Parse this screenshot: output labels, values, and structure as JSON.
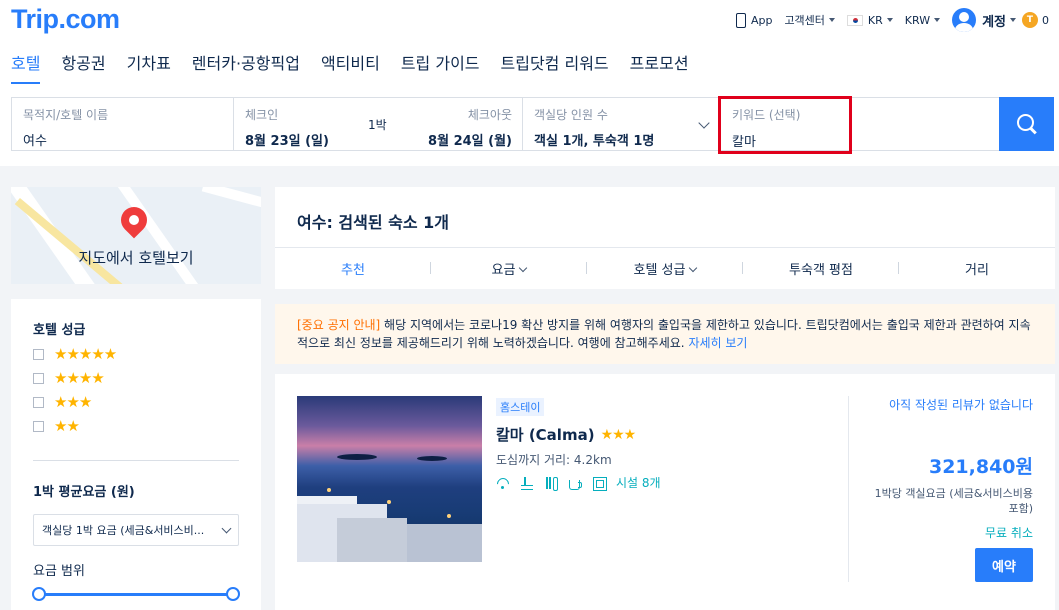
{
  "brand": {
    "logo": "Trip.com"
  },
  "topnav": {
    "app": "App",
    "support": "고객센터",
    "region": "KR",
    "currency": "KRW",
    "account": "계정",
    "points": "0",
    "coin_symbol": "T"
  },
  "mainnav": {
    "tabs": [
      {
        "label": "호텔"
      },
      {
        "label": "항공권"
      },
      {
        "label": "기차표"
      },
      {
        "label": "렌터카·공항픽업"
      },
      {
        "label": "액티비티"
      },
      {
        "label": "트립 가이드"
      },
      {
        "label": "트립닷컴 리워드"
      },
      {
        "label": "프로모션"
      }
    ]
  },
  "search": {
    "destination": {
      "label": "목적지/호텔 이름",
      "value": "여수"
    },
    "checkin": {
      "label": "체크인",
      "value": "8월 23일 (일)"
    },
    "nights": "1박",
    "checkout": {
      "label": "체크아웃",
      "value": "8월 24일 (월)"
    },
    "guests": {
      "label": "객실당 인원 수",
      "value": "객실 1개, 투숙객 1명"
    },
    "keyword": {
      "label": "키워드 (선택)",
      "value": "칼마"
    }
  },
  "sidebar": {
    "map_label": "지도에서 호텔보기",
    "star_title": "호텔 성급",
    "star_options": [
      "★★★★★",
      "★★★★",
      "★★★",
      "★★"
    ],
    "price_title": "1박 평균요금 (원)",
    "price_select": "객실당 1박 요금 (세금&서비스비...",
    "range_title": "요금 범위"
  },
  "results": {
    "title": "여수: 검색된 숙소 1개",
    "sort": [
      "추천",
      "요금",
      "호텔 성급",
      "투숙객 평점",
      "거리"
    ]
  },
  "notice": {
    "tag": "[중요 공지 안내]",
    "text": " 해당 지역에서는 코로나19 확산 방지를 위해 여행자의 출입국을 제한하고 있습니다. 트립닷컴에서는 출입국 제한과 관련하여 지속적으로 최신 정보를 제공해드리기 위해 노력하겠습니다. 여행에 참고해주세요. ",
    "more": "자세히 보기"
  },
  "hotel": {
    "type": "홈스테이",
    "name": "칼마 (Calma)",
    "stars": "★★★",
    "distance": "도심까지 거리: 4.2km",
    "facilities": "시설 8개",
    "review": "아직 작성된 리뷰가 없습니다",
    "price": "321,840원",
    "price_note": "1박당 객실요금 (세금&서비스비용 포함)",
    "cancel": "무료 취소",
    "book": "예약"
  },
  "colors": {
    "accent": "#287dfa",
    "highlight_border": "#e0001b",
    "notice_tag": "#ff6f00",
    "teal": "#06aebd"
  },
  "icons": [
    "phone-icon",
    "flag-icon",
    "avatar",
    "coin-icon",
    "search-icon",
    "pin-icon",
    "wifi-icon",
    "pool-icon",
    "food-icon",
    "cup-icon",
    "box-icon"
  ]
}
